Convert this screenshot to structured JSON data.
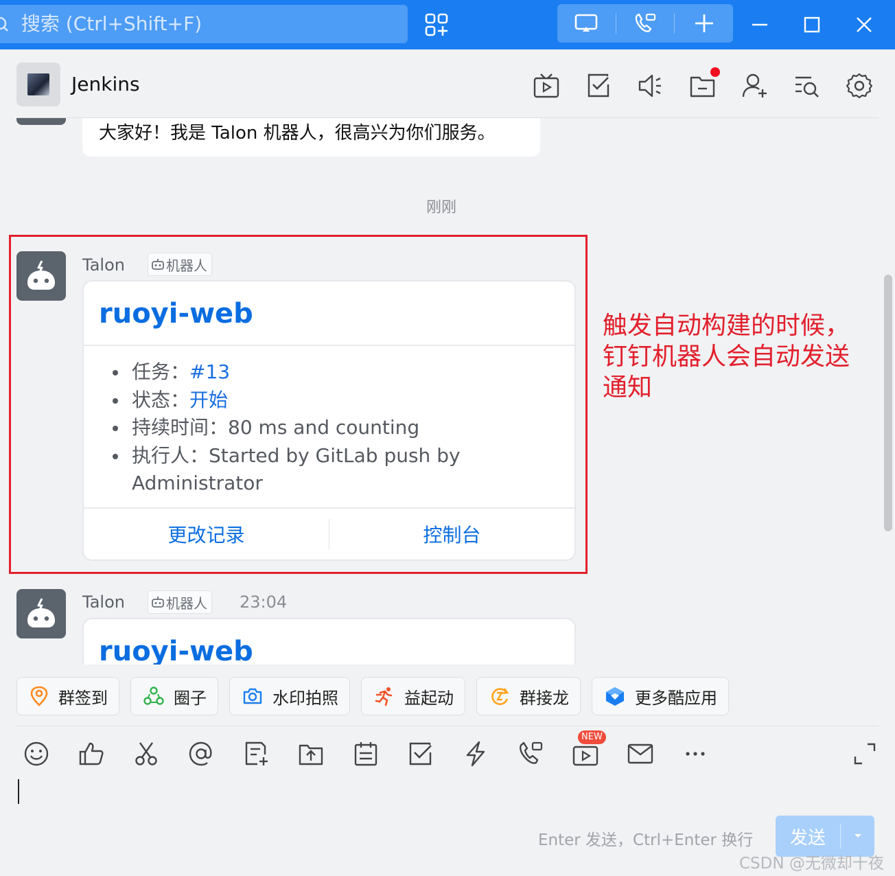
{
  "colors": {
    "accent": "#1a7ef2",
    "link": "#0a6de0",
    "annotation": "#e2202c",
    "new_badge": "#f04b3c"
  },
  "titlebar": {
    "search_placeholder": "搜索 (Ctrl+Shift+F)",
    "icons": [
      "apps-icon",
      "screen-share-icon",
      "call-icon",
      "plus-icon",
      "minimize-icon",
      "maximize-icon",
      "close-icon"
    ]
  },
  "chat": {
    "title": "Jenkins",
    "header_icons": [
      "live-icon",
      "todo-icon",
      "announcement-icon",
      "files-icon",
      "add-member-icon",
      "search-history-icon",
      "settings-icon"
    ]
  },
  "messages": {
    "previous_text": "大家好！我是 Talon 机器人，很高兴为你们服务。",
    "timestamp": "刚刚",
    "items": [
      {
        "sender": "Talon",
        "tag": "机器人",
        "time": "",
        "card": {
          "title": "ruoyi-web",
          "fields": [
            {
              "label": "任务：",
              "value": "#13"
            },
            {
              "label": "状态：",
              "value": "开始"
            },
            {
              "label": "持续时间：",
              "value": "80 ms and counting"
            },
            {
              "label": "执行人：",
              "value": "Started by GitLab push by Administrator"
            }
          ],
          "actions": [
            "更改记录",
            "控制台"
          ]
        }
      },
      {
        "sender": "Talon",
        "tag": "机器人",
        "time": "23:04",
        "card": {
          "title": "ruoyi-web"
        }
      }
    ]
  },
  "annotation": "触发自动构建的时候，钉钉机器人会自动发送通知",
  "quick_apps": [
    {
      "label": "群签到",
      "icon": "checkin-icon"
    },
    {
      "label": "圈子",
      "icon": "circle-icon"
    },
    {
      "label": "水印拍照",
      "icon": "camera-icon"
    },
    {
      "label": "益起动",
      "icon": "runner-icon"
    },
    {
      "label": "群接龙",
      "icon": "relay-icon"
    },
    {
      "label": "更多酷应用",
      "icon": "more-apps-icon"
    }
  ],
  "toolbar": {
    "icons": [
      "emoji-icon",
      "thumbs-up-icon",
      "scissors-icon",
      "mention-icon",
      "note-icon",
      "upload-file-icon",
      "schedule-icon",
      "task-icon",
      "ding-icon",
      "video-call-icon",
      "live-video-icon",
      "mail-icon",
      "more-icon",
      "expand-icon"
    ],
    "new_badge": "NEW"
  },
  "composer": {
    "hint": "Enter 发送，Ctrl+Enter 换行",
    "send_label": "发送"
  },
  "watermark": "CSDN @无微却十夜"
}
